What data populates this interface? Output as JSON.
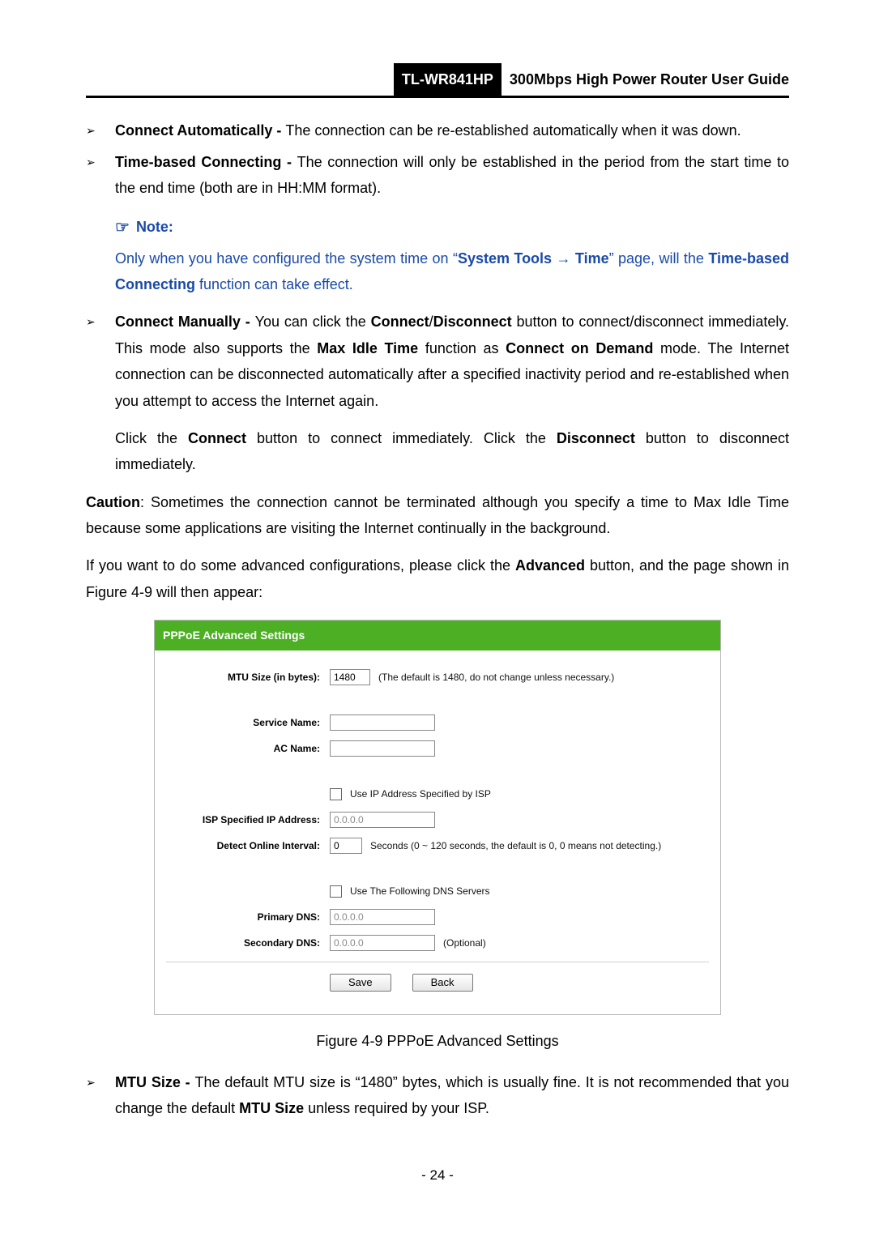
{
  "header": {
    "model": "TL-WR841HP",
    "title": "300Mbps High Power Router User Guide"
  },
  "bullets": {
    "b1_label": "Connect Automatically - ",
    "b1_text": "The connection can be re-established automatically when it was down.",
    "b2_label": "Time-based Connecting - ",
    "b2_text": "The connection will only be established in the period from the start time to the end time (both are in HH:MM format).",
    "b3_label": "Connect Manually - ",
    "b3_t1": "You can click the ",
    "b3_bold1": "Connect",
    "b3_slash": "/",
    "b3_bold2": "Disconnect",
    "b3_t2": " button to connect/disconnect immediately. This mode also supports the ",
    "b3_bold3": "Max Idle Time",
    "b3_t3": " function as ",
    "b3_bold4": "Connect on Demand",
    "b3_t4": " mode. The Internet connection can be disconnected automatically after a specified inactivity period and re-established when you attempt to access the Internet again.",
    "b4_label": "MTU Size - ",
    "b4_t1": "The default MTU size is “1480” bytes, which is usually fine. It is not recommended that you change the default ",
    "b4_bold1": "MTU Size",
    "b4_t2": " unless required by your ISP."
  },
  "note": {
    "heading": "Note:",
    "t1": "Only when you have configured the system time on “",
    "bold1": "System Tools → Time",
    "t2": "” page, will the ",
    "bold2": "Time-based Connecting",
    "t3": " function can take effect."
  },
  "indent": {
    "p_t1": "Click the ",
    "p_b1": "Connect",
    "p_t2": " button to connect immediately. Click the ",
    "p_b2": "Disconnect",
    "p_t3": " button to disconnect immediately."
  },
  "caution": {
    "label": "Caution",
    "text": ": Sometimes the connection cannot be terminated although you specify a time to Max Idle Time because some applications are visiting the Internet continually in the background."
  },
  "advanced": {
    "t1": "If you want to do some advanced configurations, please click the ",
    "b1": "Advanced",
    "t2": " button, and the page shown in Figure 4-9 will then appear:"
  },
  "panel": {
    "title": "PPPoE Advanced Settings",
    "mtu_label": "MTU Size (in bytes):",
    "mtu_value": "1480",
    "mtu_hint": "(The default is 1480, do not change unless necessary.)",
    "service_label": "Service Name:",
    "ac_label": "AC Name:",
    "chk1_text": "Use IP Address Specified by ISP",
    "isp_ip_label": "ISP Specified IP Address:",
    "isp_ip_value": "0.0.0.0",
    "detect_label": "Detect Online Interval:",
    "detect_value": "0",
    "detect_hint": "Seconds (0 ~ 120 seconds, the default is 0, 0 means not detecting.)",
    "chk2_text": "Use The Following DNS Servers",
    "pdns_label": "Primary DNS:",
    "pdns_value": "0.0.0.0",
    "sdns_label": "Secondary DNS:",
    "sdns_value": "0.0.0.0",
    "sdns_hint": "(Optional)",
    "save": "Save",
    "back": "Back"
  },
  "caption": "Figure 4-9 PPPoE Advanced Settings",
  "pagenum": "- 24 -"
}
